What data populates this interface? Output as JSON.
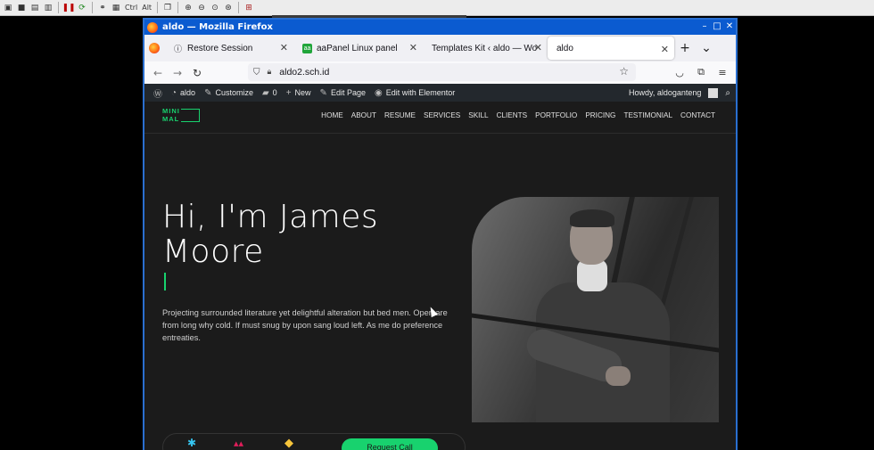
{
  "vnc_toolbar": {
    "buttons": [
      "save-icon",
      "options-icon",
      "info-icon",
      "pause-icon",
      "refresh-icon",
      "link-icon",
      "key-icon",
      "ctrl",
      "alt",
      "copy-icon",
      "zoom-in-icon",
      "zoom-out-icon",
      "zoom-auto-icon",
      "zoom-fit-icon",
      "fullscreen-icon"
    ],
    "ctrl_label": "Ctrl",
    "alt_label": "Alt"
  },
  "window": {
    "title": "aldo — Mozilla Firefox"
  },
  "tabs": [
    {
      "label": "Restore Session",
      "icon": "info-icon"
    },
    {
      "label": "aaPanel Linux panel",
      "icon": "aapanel-icon"
    },
    {
      "label": "Templates Kit ‹ aldo — Wor",
      "icon": "none"
    },
    {
      "label": "aldo",
      "icon": "none",
      "active": true
    }
  ],
  "navbar": {
    "url": "aldo2.sch.id"
  },
  "wp_admin_bar": {
    "site_name": "aldo",
    "customize": "Customize",
    "comments_count": "0",
    "new": "New",
    "edit_page": "Edit Page",
    "edit_elementor": "Edit with Elementor",
    "howdy": "Howdy, aldoganteng"
  },
  "site": {
    "logo_line1": "MINI",
    "logo_line2": "MAL",
    "menu": [
      "HOME",
      "ABOUT",
      "RESUME",
      "SERVICES",
      "SKILL",
      "CLIENTS",
      "PORTFOLIO",
      "PRICING",
      "TESTIMONIAL",
      "CONTACT"
    ],
    "hero_title": "Hi, I'm James Moore",
    "hero_text": "Projecting surrounded literature yet delightful alteration but bed men. Open are from long why cold. If must snug by upon sang loud left. As me do preference entreaties.",
    "request_button": "Request Call"
  },
  "colors": {
    "accent": "#18d26e",
    "titlebar": "#0b5bd0",
    "page_bg": "#1b1b1b",
    "wpbar_bg": "#23282d"
  }
}
